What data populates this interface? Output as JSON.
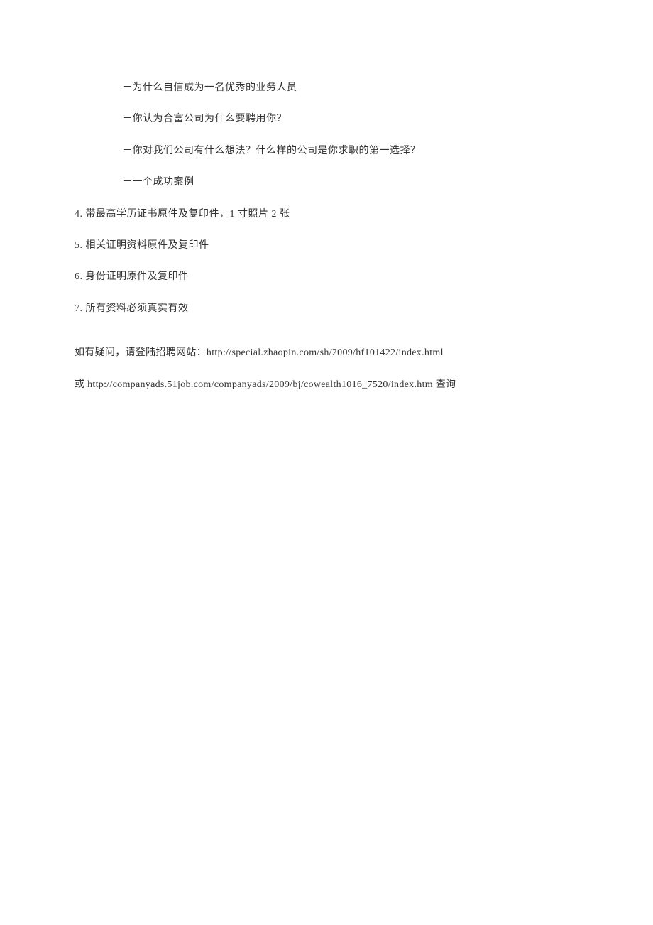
{
  "lines": {
    "indent1": "－为什么自信成为一名优秀的业务人员",
    "indent2": "－你认为合富公司为什么要聘用你？",
    "indent3": "－你对我们公司有什么想法？什么样的公司是你求职的第一选择？",
    "indent4": "－一个成功案例",
    "item4": "4. 带最高学历证书原件及复印件，1 寸照片 2 张",
    "item5": "5. 相关证明资料原件及复印件",
    "item6": "6. 身份证明原件及复印件",
    "item7": "7. 所有资料必须真实有效",
    "inquiry": "如有疑问，请登陆招聘网站：http://special.zhaopin.com/sh/2009/hf101422/index.html",
    "orUrl": "或 http://companyads.51job.com/companyads/2009/bj/cowealth1016_7520/index.htm 查询"
  }
}
